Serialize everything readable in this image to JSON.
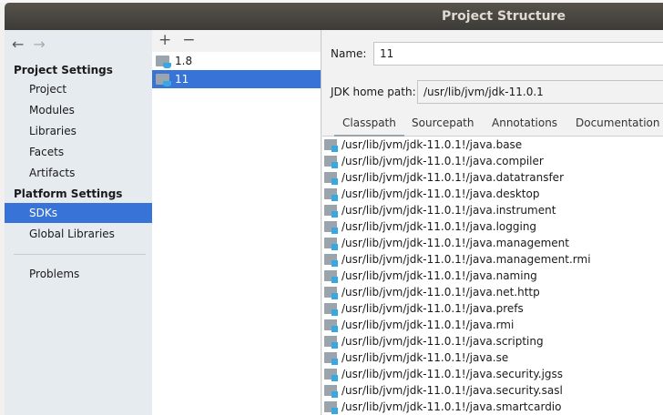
{
  "window": {
    "title": "Project Structure"
  },
  "sidebar": {
    "back": "←",
    "forward": "→",
    "project_settings": "Project Settings",
    "platform_settings": "Platform Settings",
    "items": [
      "Project",
      "Modules",
      "Libraries",
      "Facets",
      "Artifacts"
    ],
    "platform_items": [
      "SDKs",
      "Global Libraries"
    ],
    "problems": "Problems"
  },
  "sdk_list": {
    "add": "+",
    "remove": "−",
    "items": [
      "1.8",
      "11"
    ],
    "selected": "11"
  },
  "detail": {
    "name_label": "Name:",
    "name_value": "11",
    "home_label": "JDK home path:",
    "home_value": "/usr/lib/jvm/jdk-11.0.1",
    "tabs": [
      "Classpath",
      "Sourcepath",
      "Annotations",
      "Documentation P"
    ],
    "classpath": [
      "/usr/lib/jvm/jdk-11.0.1!/java.base",
      "/usr/lib/jvm/jdk-11.0.1!/java.compiler",
      "/usr/lib/jvm/jdk-11.0.1!/java.datatransfer",
      "/usr/lib/jvm/jdk-11.0.1!/java.desktop",
      "/usr/lib/jvm/jdk-11.0.1!/java.instrument",
      "/usr/lib/jvm/jdk-11.0.1!/java.logging",
      "/usr/lib/jvm/jdk-11.0.1!/java.management",
      "/usr/lib/jvm/jdk-11.0.1!/java.management.rmi",
      "/usr/lib/jvm/jdk-11.0.1!/java.naming",
      "/usr/lib/jvm/jdk-11.0.1!/java.net.http",
      "/usr/lib/jvm/jdk-11.0.1!/java.prefs",
      "/usr/lib/jvm/jdk-11.0.1!/java.rmi",
      "/usr/lib/jvm/jdk-11.0.1!/java.scripting",
      "/usr/lib/jvm/jdk-11.0.1!/java.se",
      "/usr/lib/jvm/jdk-11.0.1!/java.security.jgss",
      "/usr/lib/jvm/jdk-11.0.1!/java.security.sasl",
      "/usr/lib/jvm/jdk-11.0.1!/java.smartcardio"
    ]
  }
}
